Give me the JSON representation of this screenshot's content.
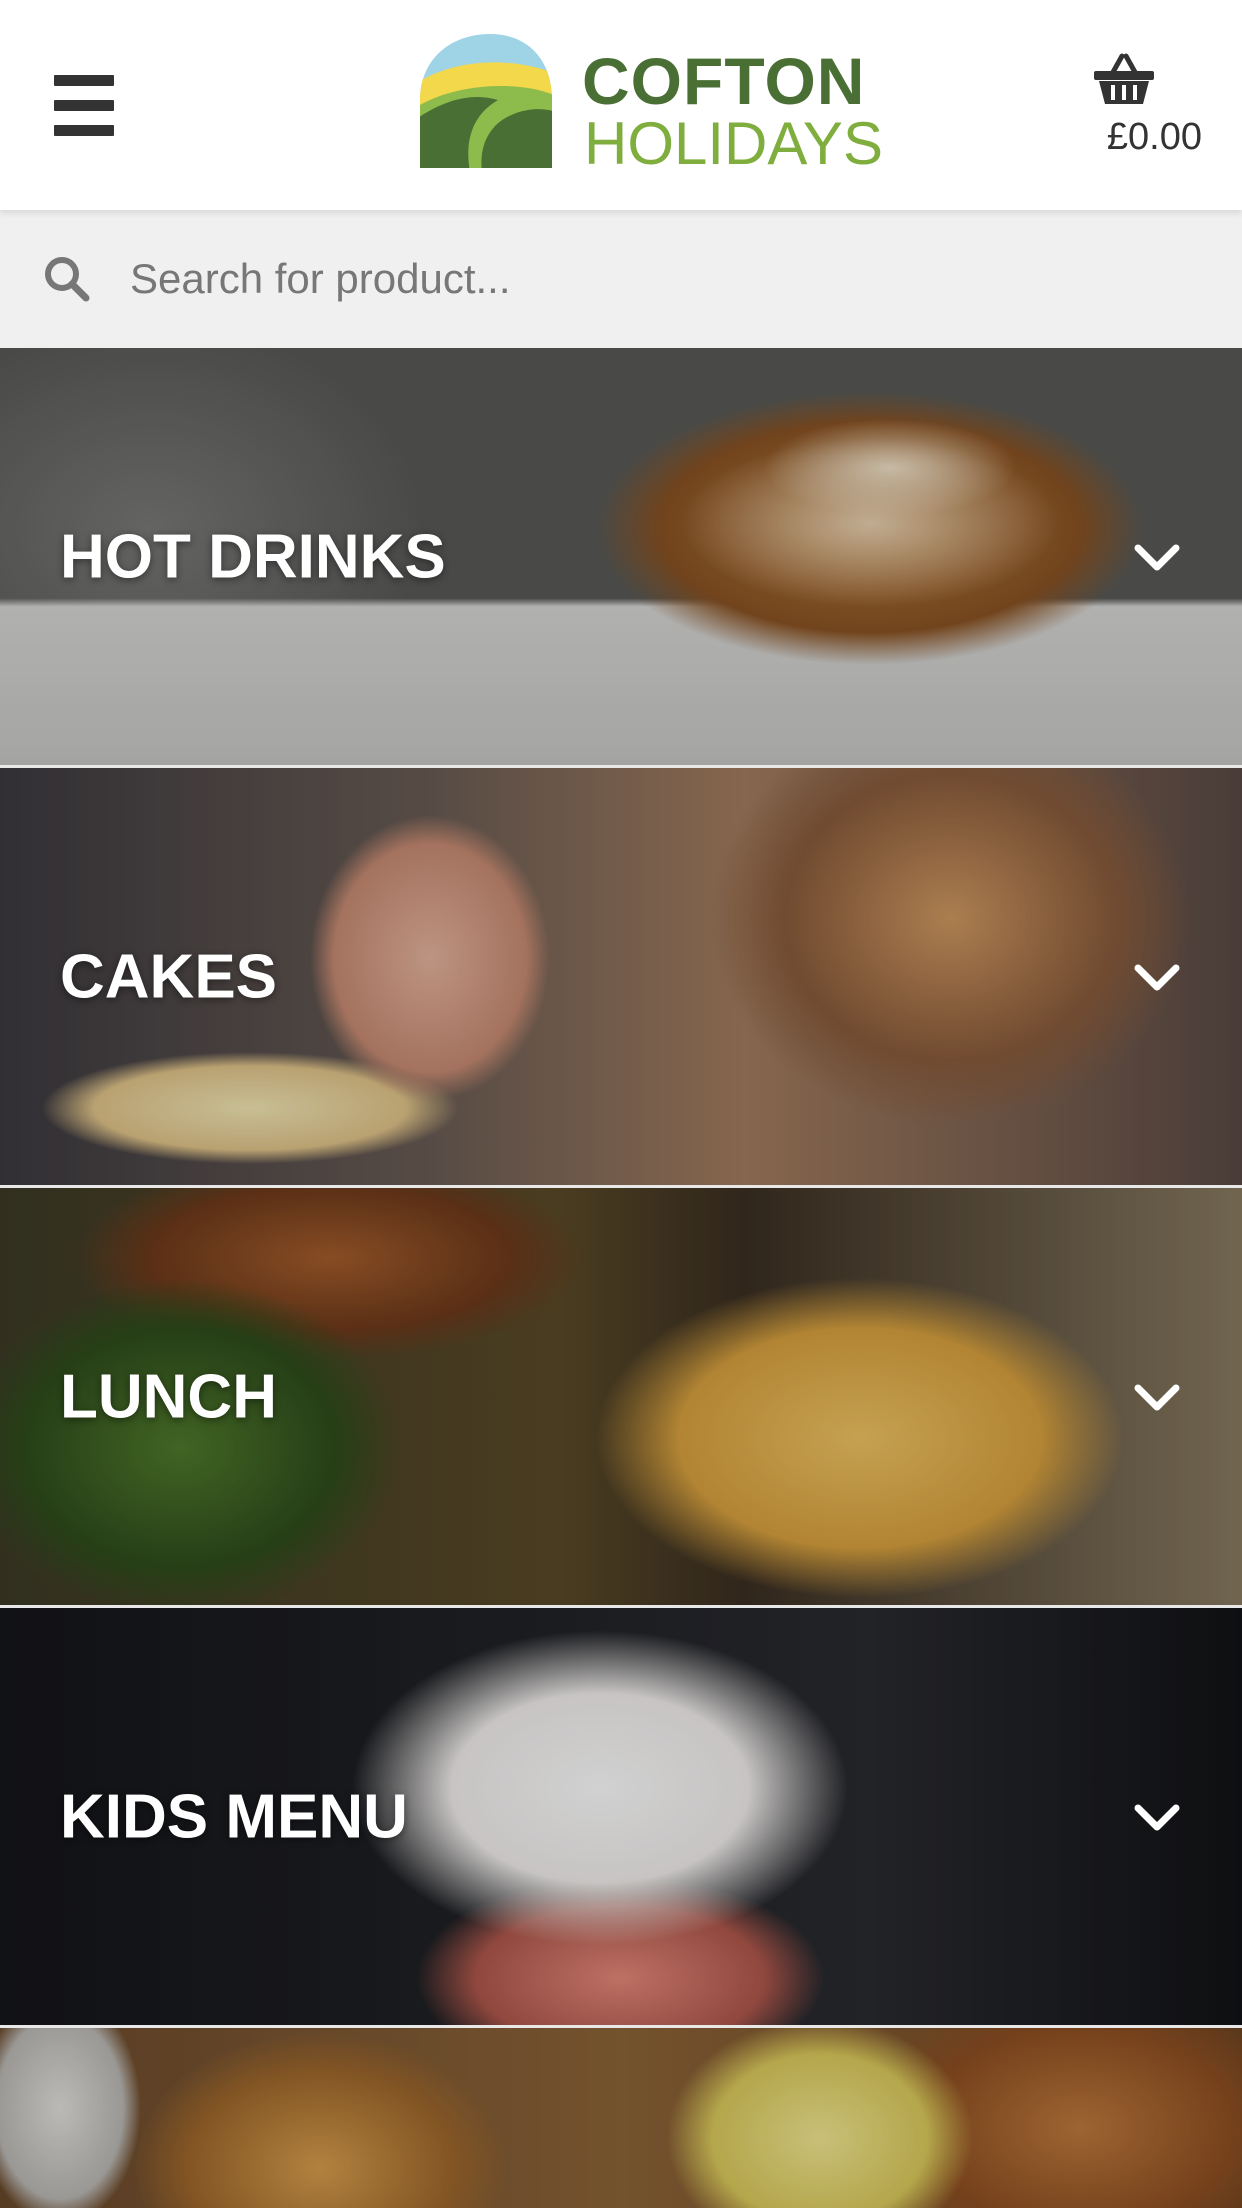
{
  "header": {
    "menu_icon": "hamburger-menu-icon",
    "logo": {
      "line1": "COFTON",
      "line2": "HOLIDAYS",
      "colors": {
        "dark_green": "#4a6f34",
        "light_green": "#7fae3e",
        "yellow": "#f2d84a",
        "sky_blue": "#9fd3e6"
      }
    },
    "cart": {
      "icon": "basket-icon",
      "total": "£0.00"
    }
  },
  "search": {
    "icon": "search-icon",
    "placeholder": "Search for product...",
    "value": ""
  },
  "categories": [
    {
      "label": "HOT DRINKS",
      "icon": "chevron-down-icon"
    },
    {
      "label": "CAKES",
      "icon": "chevron-down-icon"
    },
    {
      "label": "LUNCH",
      "icon": "chevron-down-icon"
    },
    {
      "label": "KIDS MENU",
      "icon": "chevron-down-icon"
    },
    {
      "label": "",
      "icon": "chevron-down-icon"
    }
  ],
  "colors": {
    "header_bg": "#ffffff",
    "search_bg": "#f0f0f0",
    "text_dark": "#333333",
    "placeholder": "#777777",
    "banner_text": "#ffffff"
  }
}
